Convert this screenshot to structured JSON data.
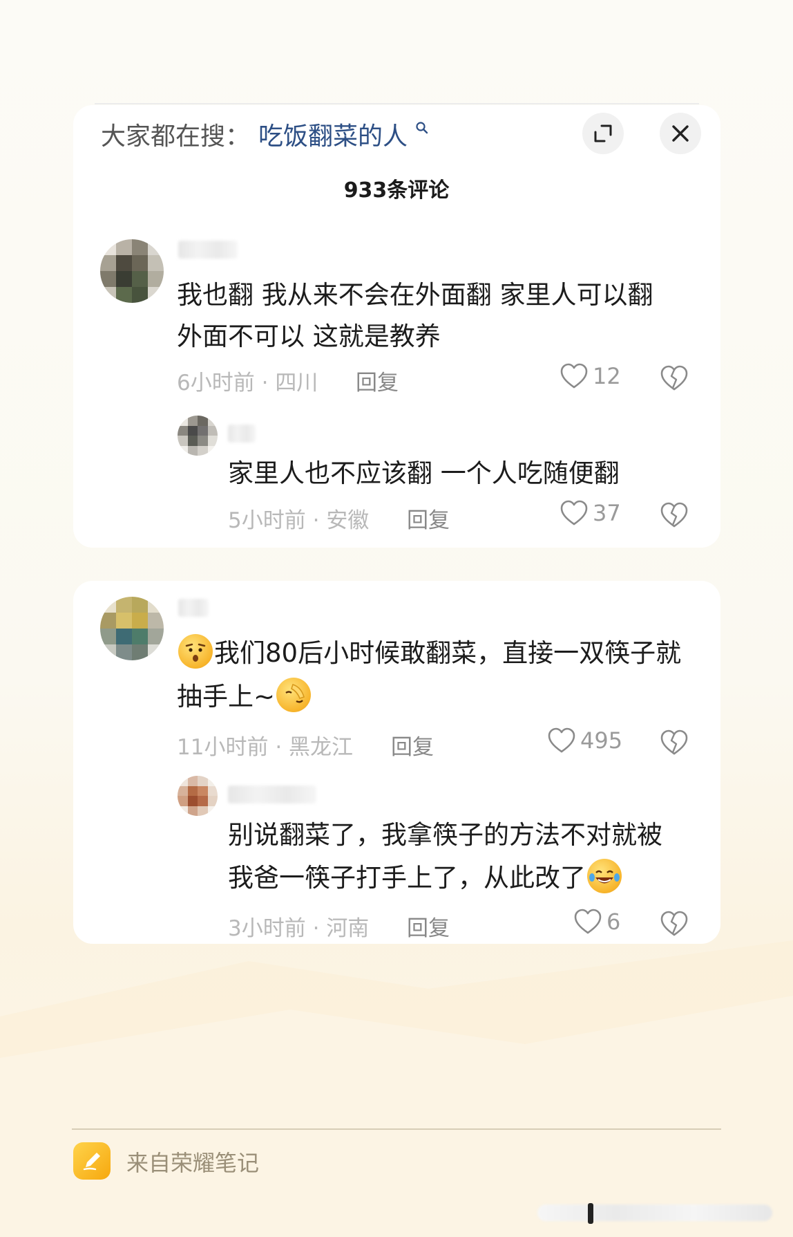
{
  "search": {
    "label": "大家都在搜：",
    "term": "吃饭翻菜的人"
  },
  "comment_count": "933条评论",
  "comments": [
    {
      "text_lines": [
        "我也翻  我从来不会在外面翻  家里人可以翻",
        "外面不可以    这就是教养"
      ],
      "time": "6小时前",
      "location": "四川",
      "reply_label": "回复",
      "likes": "12",
      "reply": {
        "text_lines": [
          "家里人也不应该翻 一个人吃随便翻"
        ],
        "time": "5小时前",
        "location": "安徽",
        "reply_label": "回复",
        "likes": "37"
      }
    },
    {
      "text_lines": [
        "我们80后小时候敢翻菜，直接一双筷子就",
        "抽手上~"
      ],
      "time": "11小时前",
      "location": "黑龙江",
      "reply_label": "回复",
      "likes": "495",
      "reply": {
        "text_lines": [
          "别说翻菜了，我拿筷子的方法不对就被",
          "我爸一筷子打手上了，从此改了"
        ],
        "time": "3小时前",
        "location": "河南",
        "reply_label": "回复",
        "likes": "6"
      }
    }
  ],
  "footer": {
    "source_text": "来自荣耀笔记"
  },
  "colors": {
    "search_term": "#2d4f85",
    "meta": "#b8b8b8",
    "text": "#1c1c1c",
    "app_icon": "#f6a80f"
  }
}
